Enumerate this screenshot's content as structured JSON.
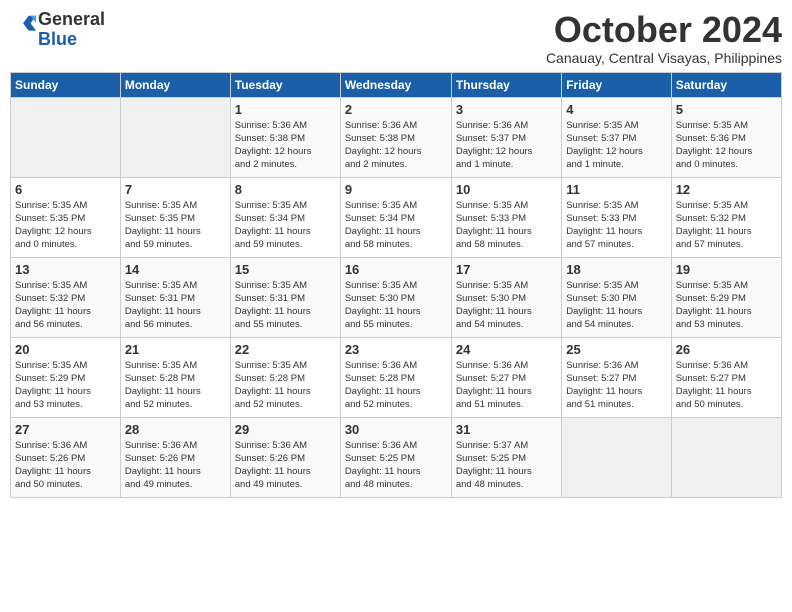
{
  "header": {
    "logo_line1": "General",
    "logo_line2": "Blue",
    "month": "October 2024",
    "location": "Canauay, Central Visayas, Philippines"
  },
  "weekdays": [
    "Sunday",
    "Monday",
    "Tuesday",
    "Wednesday",
    "Thursday",
    "Friday",
    "Saturday"
  ],
  "weeks": [
    [
      {
        "day": "",
        "info": ""
      },
      {
        "day": "",
        "info": ""
      },
      {
        "day": "1",
        "info": "Sunrise: 5:36 AM\nSunset: 5:38 PM\nDaylight: 12 hours\nand 2 minutes."
      },
      {
        "day": "2",
        "info": "Sunrise: 5:36 AM\nSunset: 5:38 PM\nDaylight: 12 hours\nand 2 minutes."
      },
      {
        "day": "3",
        "info": "Sunrise: 5:36 AM\nSunset: 5:37 PM\nDaylight: 12 hours\nand 1 minute."
      },
      {
        "day": "4",
        "info": "Sunrise: 5:35 AM\nSunset: 5:37 PM\nDaylight: 12 hours\nand 1 minute."
      },
      {
        "day": "5",
        "info": "Sunrise: 5:35 AM\nSunset: 5:36 PM\nDaylight: 12 hours\nand 0 minutes."
      }
    ],
    [
      {
        "day": "6",
        "info": "Sunrise: 5:35 AM\nSunset: 5:35 PM\nDaylight: 12 hours\nand 0 minutes."
      },
      {
        "day": "7",
        "info": "Sunrise: 5:35 AM\nSunset: 5:35 PM\nDaylight: 11 hours\nand 59 minutes."
      },
      {
        "day": "8",
        "info": "Sunrise: 5:35 AM\nSunset: 5:34 PM\nDaylight: 11 hours\nand 59 minutes."
      },
      {
        "day": "9",
        "info": "Sunrise: 5:35 AM\nSunset: 5:34 PM\nDaylight: 11 hours\nand 58 minutes."
      },
      {
        "day": "10",
        "info": "Sunrise: 5:35 AM\nSunset: 5:33 PM\nDaylight: 11 hours\nand 58 minutes."
      },
      {
        "day": "11",
        "info": "Sunrise: 5:35 AM\nSunset: 5:33 PM\nDaylight: 11 hours\nand 57 minutes."
      },
      {
        "day": "12",
        "info": "Sunrise: 5:35 AM\nSunset: 5:32 PM\nDaylight: 11 hours\nand 57 minutes."
      }
    ],
    [
      {
        "day": "13",
        "info": "Sunrise: 5:35 AM\nSunset: 5:32 PM\nDaylight: 11 hours\nand 56 minutes."
      },
      {
        "day": "14",
        "info": "Sunrise: 5:35 AM\nSunset: 5:31 PM\nDaylight: 11 hours\nand 56 minutes."
      },
      {
        "day": "15",
        "info": "Sunrise: 5:35 AM\nSunset: 5:31 PM\nDaylight: 11 hours\nand 55 minutes."
      },
      {
        "day": "16",
        "info": "Sunrise: 5:35 AM\nSunset: 5:30 PM\nDaylight: 11 hours\nand 55 minutes."
      },
      {
        "day": "17",
        "info": "Sunrise: 5:35 AM\nSunset: 5:30 PM\nDaylight: 11 hours\nand 54 minutes."
      },
      {
        "day": "18",
        "info": "Sunrise: 5:35 AM\nSunset: 5:30 PM\nDaylight: 11 hours\nand 54 minutes."
      },
      {
        "day": "19",
        "info": "Sunrise: 5:35 AM\nSunset: 5:29 PM\nDaylight: 11 hours\nand 53 minutes."
      }
    ],
    [
      {
        "day": "20",
        "info": "Sunrise: 5:35 AM\nSunset: 5:29 PM\nDaylight: 11 hours\nand 53 minutes."
      },
      {
        "day": "21",
        "info": "Sunrise: 5:35 AM\nSunset: 5:28 PM\nDaylight: 11 hours\nand 52 minutes."
      },
      {
        "day": "22",
        "info": "Sunrise: 5:35 AM\nSunset: 5:28 PM\nDaylight: 11 hours\nand 52 minutes."
      },
      {
        "day": "23",
        "info": "Sunrise: 5:36 AM\nSunset: 5:28 PM\nDaylight: 11 hours\nand 52 minutes."
      },
      {
        "day": "24",
        "info": "Sunrise: 5:36 AM\nSunset: 5:27 PM\nDaylight: 11 hours\nand 51 minutes."
      },
      {
        "day": "25",
        "info": "Sunrise: 5:36 AM\nSunset: 5:27 PM\nDaylight: 11 hours\nand 51 minutes."
      },
      {
        "day": "26",
        "info": "Sunrise: 5:36 AM\nSunset: 5:27 PM\nDaylight: 11 hours\nand 50 minutes."
      }
    ],
    [
      {
        "day": "27",
        "info": "Sunrise: 5:36 AM\nSunset: 5:26 PM\nDaylight: 11 hours\nand 50 minutes."
      },
      {
        "day": "28",
        "info": "Sunrise: 5:36 AM\nSunset: 5:26 PM\nDaylight: 11 hours\nand 49 minutes."
      },
      {
        "day": "29",
        "info": "Sunrise: 5:36 AM\nSunset: 5:26 PM\nDaylight: 11 hours\nand 49 minutes."
      },
      {
        "day": "30",
        "info": "Sunrise: 5:36 AM\nSunset: 5:25 PM\nDaylight: 11 hours\nand 48 minutes."
      },
      {
        "day": "31",
        "info": "Sunrise: 5:37 AM\nSunset: 5:25 PM\nDaylight: 11 hours\nand 48 minutes."
      },
      {
        "day": "",
        "info": ""
      },
      {
        "day": "",
        "info": ""
      }
    ]
  ]
}
